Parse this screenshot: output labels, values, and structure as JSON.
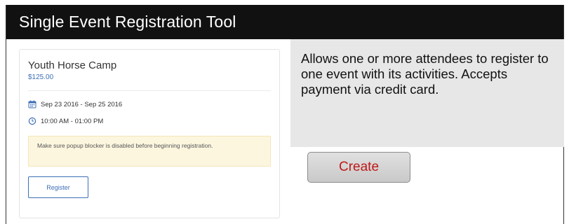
{
  "header": {
    "title": "Single Event Registration Tool"
  },
  "event_card": {
    "title": "Youth Horse Camp",
    "price": "$125.00",
    "dates": "Sep 23 2016 - Sep 25 2016",
    "time": "10:00 AM - 01:00 PM",
    "notice": "Make sure popup blocker is disabled before beginning registration.",
    "register_label": "Register",
    "date_icon": "calendar-icon",
    "time_icon": "clock-icon"
  },
  "description": {
    "text": "Allows one or more attendees to register to one event with its activities. Accepts payment via credit card."
  },
  "actions": {
    "create_label": "Create"
  },
  "colors": {
    "titlebar_bg": "#111111",
    "link_blue": "#3d6fb6",
    "notice_bg": "#fcf6df",
    "desc_bg": "#e7e7e7",
    "create_text": "#c01818"
  }
}
